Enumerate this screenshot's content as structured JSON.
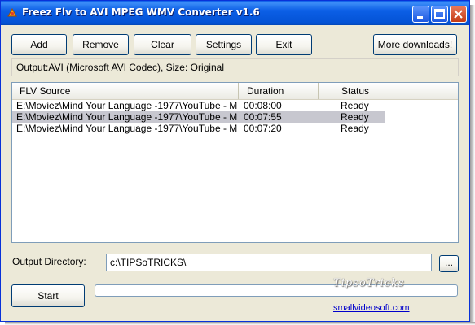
{
  "window": {
    "title": "Freez Flv to AVI MPEG WMV Converter v1.6"
  },
  "toolbar": {
    "add_label": "Add",
    "remove_label": "Remove",
    "clear_label": "Clear",
    "settings_label": "Settings",
    "exit_label": "Exit",
    "more_downloads_label": "More downloads!"
  },
  "output_info": "Output:AVI (Microsoft AVI Codec), Size: Original",
  "list": {
    "columns": [
      "FLV Source",
      "Duration",
      "Status"
    ],
    "rows": [
      {
        "source": "E:\\Moviez\\Mind Your Language -1977\\YouTube - Min...",
        "duration": "00:08:00",
        "status": "Ready"
      },
      {
        "source": "E:\\Moviez\\Mind Your Language -1977\\YouTube - Min...",
        "duration": "00:07:55",
        "status": "Ready"
      },
      {
        "source": "E:\\Moviez\\Mind Your Language -1977\\YouTube - Min...",
        "duration": "00:07:20",
        "status": "Ready"
      }
    ],
    "selected_row": 1
  },
  "output_directory": {
    "label": "Output Directory:",
    "value": "c:\\TIPSoTRICKS\\",
    "browse_label": "..."
  },
  "start_label": "Start",
  "progress": 0,
  "watermark": "TipsoTricks",
  "link": "smallvideosoft.com",
  "colors": {
    "titlebar": "#0453d6",
    "window_bg": "#ece9d8",
    "selection": "#c7c7cf",
    "link": "#0000cc"
  },
  "icons": [
    "app-icon",
    "minimize-icon",
    "maximize-icon",
    "close-icon"
  ]
}
